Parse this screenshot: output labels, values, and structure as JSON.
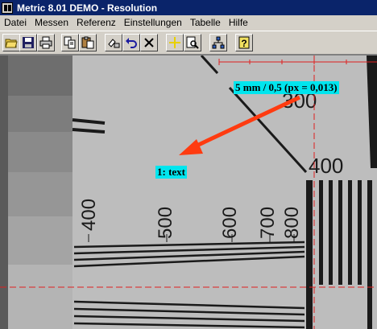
{
  "window": {
    "title": "Metric 8.01 DEMO - Resolution"
  },
  "menu": {
    "items": [
      {
        "key": "datei",
        "label": "Datei"
      },
      {
        "key": "messen",
        "label": "Messen"
      },
      {
        "key": "referenz",
        "label": "Referenz"
      },
      {
        "key": "einstellungen",
        "label": "Einstellungen"
      },
      {
        "key": "tabelle",
        "label": "Tabelle"
      },
      {
        "key": "hilfe",
        "label": "Hilfe"
      }
    ]
  },
  "toolbar": {
    "buttons": [
      {
        "icon": "open-folder-icon"
      },
      {
        "icon": "save-disk-icon"
      },
      {
        "icon": "print-icon"
      },
      {
        "icon": "copy-icon"
      },
      {
        "icon": "paste-icon"
      },
      {
        "icon": "measure-tool-icon"
      },
      {
        "icon": "undo-icon"
      },
      {
        "icon": "delete-x-icon"
      },
      {
        "icon": "crosshair-icon"
      },
      {
        "icon": "zoom-page-icon"
      },
      {
        "icon": "network-tree-icon"
      },
      {
        "icon": "help-icon"
      }
    ]
  },
  "image": {
    "measurement_label": "5 mm / 0,5 (px = 0,013)",
    "text_label": "1: text",
    "chart_numbers_vertical": [
      "400",
      "500",
      "600",
      "700",
      "800"
    ],
    "chart_numbers_horizontal": [
      "300",
      "400"
    ],
    "colors": {
      "label_bg": "#00e5ee",
      "arrow": "#ff3b10",
      "guide_line": "#e02020"
    }
  }
}
